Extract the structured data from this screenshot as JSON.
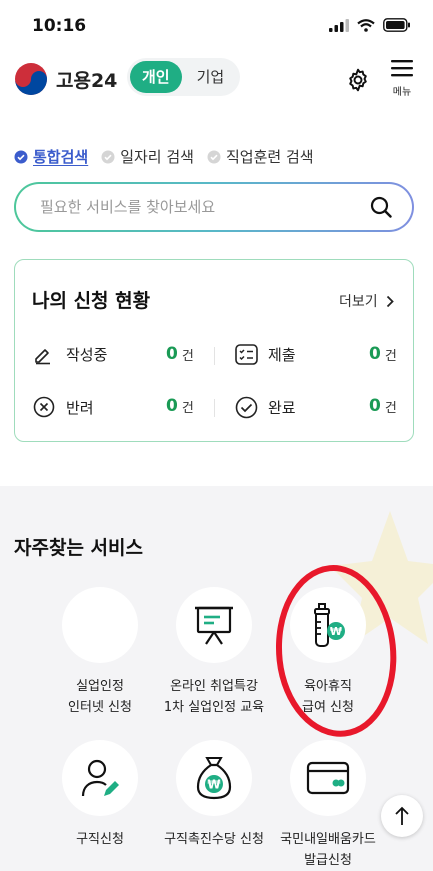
{
  "status_bar": {
    "time": "10:16"
  },
  "header": {
    "logo_text": "고용24",
    "toggle": [
      "개인",
      "기업"
    ],
    "active_toggle": "개인",
    "menu_label": "메뉴"
  },
  "search": {
    "tabs": [
      "통합검색",
      "일자리 검색",
      "직업훈련 검색"
    ],
    "active_tab": "통합검색",
    "placeholder": "필요한 서비스를 찾아보세요"
  },
  "status_card": {
    "title": "나의 신청 현황",
    "more": "더보기",
    "items": [
      {
        "label": "작성중",
        "count": "0",
        "unit": "건",
        "icon": "pencil-icon"
      },
      {
        "label": "제출",
        "count": "0",
        "unit": "건",
        "icon": "checklist-icon"
      },
      {
        "label": "반려",
        "count": "0",
        "unit": "건",
        "icon": "x-circle-icon"
      },
      {
        "label": "완료",
        "count": "0",
        "unit": "건",
        "icon": "check-circle-icon"
      }
    ]
  },
  "services": {
    "title": "자주찾는 서비스",
    "items": [
      {
        "line1": "실업인정",
        "line2": "인터넷 신청",
        "icon": "blank"
      },
      {
        "line1": "온라인 취업특강",
        "line2": "1차 실업인정 교육",
        "icon": "presentation-board-icon"
      },
      {
        "line1": "육아휴직",
        "line2": "급여 신청",
        "icon": "baby-bottle-icon"
      },
      {
        "line1": "구직신청",
        "line2": "",
        "icon": "person-edit-icon"
      },
      {
        "line1": "구직촉진수당 신청",
        "line2": "",
        "icon": "money-bag-icon"
      },
      {
        "line1": "국민내일배움카드",
        "line2": "발급신청",
        "icon": "card-icon"
      }
    ]
  },
  "colors": {
    "accent": "#1fae84",
    "count": "#1a9a55",
    "tab_active": "#3b5ccc",
    "annotation": "#e8182b"
  }
}
